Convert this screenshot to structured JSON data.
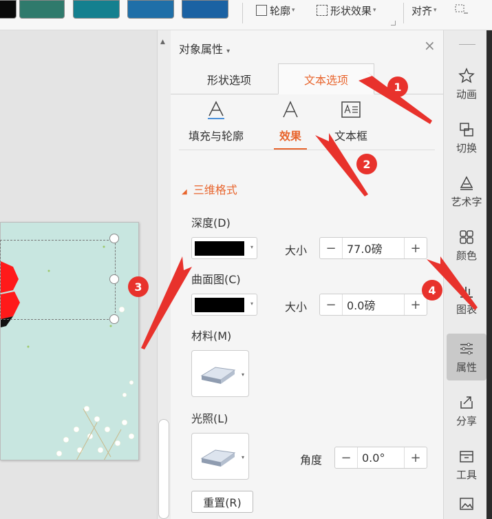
{
  "ribbon": {
    "outline_label": "轮廓",
    "shape_effect_label": "形状效果",
    "align_label": "对齐",
    "swatches": [
      "#0a0a0a",
      "#2f7a6c",
      "#14808f",
      "#1f6fa8",
      "#1b62a3"
    ]
  },
  "panel": {
    "title": "对象属性",
    "close": "×",
    "tabs": {
      "shape": "形状选项",
      "text": "文本选项"
    },
    "subtabs": {
      "fill": "填充与轮廓",
      "effect": "效果",
      "textbox": "文本框"
    },
    "section": "三维格式",
    "depth": {
      "label": "深度(D)",
      "color": "#000000",
      "size_label": "大小",
      "value": "77.0磅"
    },
    "contour": {
      "label": "曲面图(C)",
      "color": "#000000",
      "size_label": "大小",
      "value": "0.0磅"
    },
    "material": {
      "label": "材料(M)"
    },
    "lighting": {
      "label": "光照(L)",
      "angle_label": "角度",
      "angle_value": "0.0°"
    },
    "reset": "重置(R)",
    "minus": "−",
    "plus": "+"
  },
  "side": {
    "items": [
      "动画",
      "切换",
      "艺术字",
      "颜色",
      "图表",
      "属性",
      "分享",
      "工具"
    ]
  },
  "markers": [
    "1",
    "2",
    "3",
    "4"
  ],
  "colors": {
    "accent": "#e8642c",
    "marker": "#e8322c",
    "slide_bg": "#c8e6e0"
  }
}
